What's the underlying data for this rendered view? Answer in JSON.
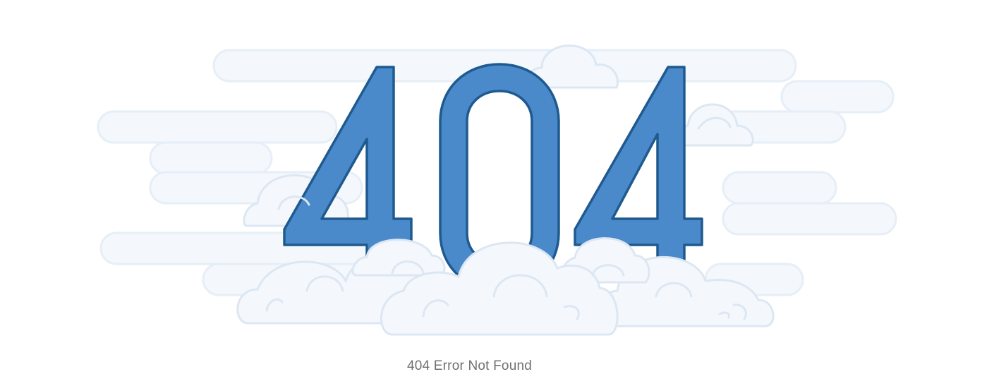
{
  "error": {
    "code_digits": [
      "4",
      "0",
      "4"
    ],
    "message": "404 Error Not Found"
  },
  "colors": {
    "digit_fill": "#4a89ca",
    "digit_stroke": "#1f5a8f",
    "cloud_fill": "#f4f8fc",
    "cloud_stroke": "#dce7f3",
    "message_text": "#707070",
    "background": "#ffffff"
  },
  "illustration": {
    "icon": "cloud-illustration"
  }
}
